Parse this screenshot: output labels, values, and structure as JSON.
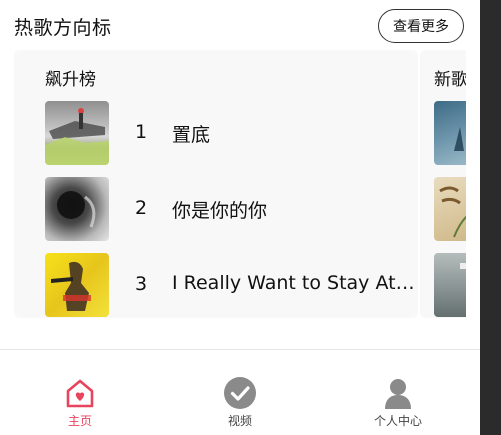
{
  "header": {
    "title": "热歌方向标",
    "more_label": "查看更多"
  },
  "charts": [
    {
      "title": "飙升榜",
      "songs": [
        {
          "rank": "1",
          "name": "置底"
        },
        {
          "rank": "2",
          "name": "你是你的你"
        },
        {
          "rank": "3",
          "name": "I Really Want to Stay At Your House"
        }
      ]
    },
    {
      "title": "新歌"
    }
  ],
  "tabs": [
    {
      "label": "主页",
      "icon": "home-icon",
      "active": true
    },
    {
      "label": "视频",
      "icon": "video-check-icon",
      "active": false
    },
    {
      "label": "个人中心",
      "icon": "user-icon",
      "active": false
    }
  ],
  "colors": {
    "accent": "#e8445d",
    "card_bg": "#f8f8f8",
    "icon_gray": "#8a8a8a"
  }
}
